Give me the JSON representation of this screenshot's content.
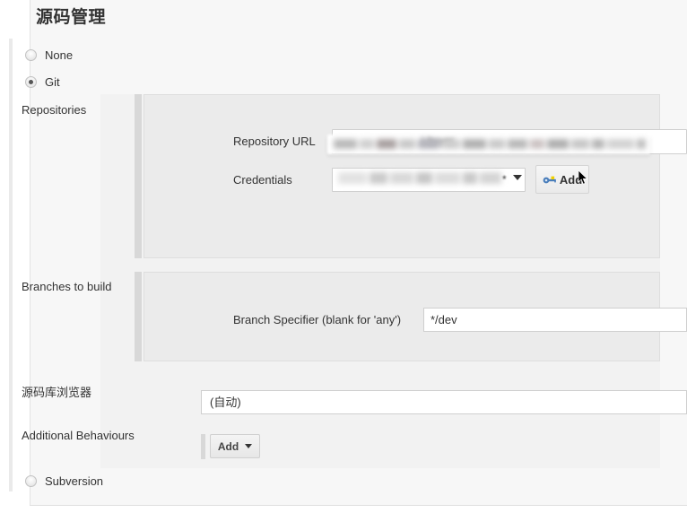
{
  "page": {
    "title": "源码管理"
  },
  "scm": {
    "options": [
      {
        "label": "None",
        "selected": false
      },
      {
        "label": "Git",
        "selected": true
      },
      {
        "label": "Subversion",
        "selected": false
      }
    ]
  },
  "git": {
    "repositories": {
      "label": "Repositories",
      "repository_url": {
        "label": "Repository URL",
        "value": "",
        "redacted": true,
        "suggestion_ghost": "i-buyer"
      },
      "credentials": {
        "label": "Credentials",
        "value": "",
        "redacted": true,
        "value_suffix": "*",
        "add_button": {
          "label": "Add",
          "icon": "key-icon"
        }
      }
    },
    "branches": {
      "label": "Branches to build",
      "branch_specifier": {
        "label": "Branch Specifier (blank for 'any')",
        "value": "*/dev"
      }
    },
    "repository_browser": {
      "label": "源码库浏览器",
      "value": "(自动)"
    },
    "additional_behaviours": {
      "label": "Additional Behaviours",
      "add_button": {
        "label": "Add"
      }
    }
  },
  "colors": {
    "page_background": "#f7f7f7",
    "panel_background": "#f2f2f2",
    "subpanel_background": "#ebebeb",
    "text": "#333333",
    "border": "#cfcfcf",
    "key_icon_body": "#4a7ebb",
    "key_icon_accent": "#f0d000"
  }
}
